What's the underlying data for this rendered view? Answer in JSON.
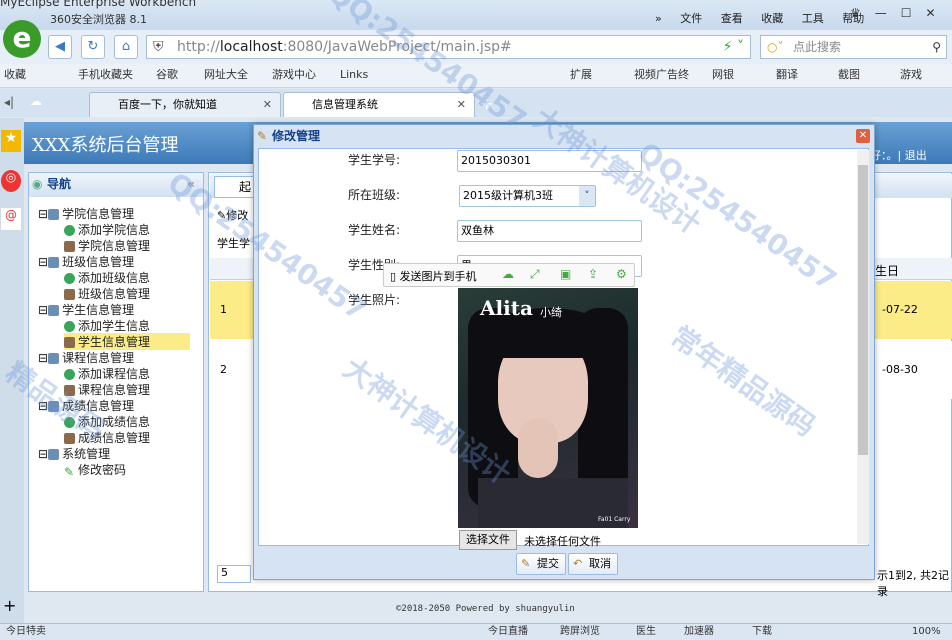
{
  "browser": {
    "eclipse_title": "MyEclipse Enterprise Workbench",
    "title": "360安全浏览器 8.1",
    "menu": [
      "文件",
      "查看",
      "收藏",
      "工具",
      "帮助"
    ],
    "url_host": "localhost",
    "url_prefix": "http://",
    "url_rest": ":8080/JavaWebProject/main.jsp#",
    "search_placeholder": "点此搜索",
    "favorites": [
      "收藏",
      "手机收藏夹",
      "谷歌",
      "网址大全",
      "游戏中心",
      "Links"
    ],
    "fav_right": [
      "扩展",
      "视频广告终",
      "网银",
      "翻译",
      "截图",
      "游戏"
    ],
    "tabs": [
      {
        "label": "百度一下，你就知道"
      },
      {
        "label": "信息管理系统"
      }
    ]
  },
  "app": {
    "title": "XXX系统后台管理",
    "header_right": "好：。| 退出",
    "nav_title": "导航",
    "tree": [
      {
        "label": "学院信息管理",
        "children": [
          "添加学院信息",
          "学院信息管理"
        ]
      },
      {
        "label": "班级信息管理",
        "children": [
          "添加班级信息",
          "班级信息管理"
        ]
      },
      {
        "label": "学生信息管理",
        "children": [
          "添加学生信息",
          "学生信息管理"
        ]
      },
      {
        "label": "课程信息管理",
        "children": [
          "添加课程信息",
          "课程信息管理"
        ]
      },
      {
        "label": "成绩信息管理",
        "children": [
          "添加成绩信息",
          "成绩信息管理"
        ]
      },
      {
        "label": "系统管理",
        "children": [
          "修改密码"
        ]
      }
    ],
    "main_tab": "起",
    "toolbar_edit": "修改",
    "col_first": "学生学",
    "col_birth": "生日",
    "rows": [
      {
        "num": "1",
        "date": "-07-22"
      },
      {
        "num": "2",
        "date": "-08-30"
      }
    ],
    "page_size": "5",
    "paging_info": "示1到2, 共2记录",
    "footer": "©2018-2050  Powered by shuangyulin"
  },
  "modal": {
    "title": "修改管理",
    "fields": {
      "student_no_label": "学生学号:",
      "student_no": "2015030301",
      "class_label": "所在班级:",
      "class": "2015级计算机3班",
      "name_label": "学生姓名:",
      "name": "双鱼林",
      "gender_label": "学生性别:",
      "gender": "男",
      "photo_label": "学生照片:"
    },
    "photo_text": "Alita",
    "photo_text2": "小绮",
    "photo_foot": "Fa01 Carry",
    "float_send": "发送图片到手机",
    "file_button": "选择文件",
    "file_text": "未选择任何文件",
    "submit": "提交",
    "cancel": "取消"
  },
  "status": {
    "left": "今日特卖",
    "items": [
      "今日直播",
      "跨屏浏览",
      "医生",
      "加速器",
      "下载"
    ],
    "zoom": "100%"
  },
  "watermark": [
    "QQ:254540457",
    "大神计算机设计",
    "常年精品源码",
    "精品源码"
  ]
}
